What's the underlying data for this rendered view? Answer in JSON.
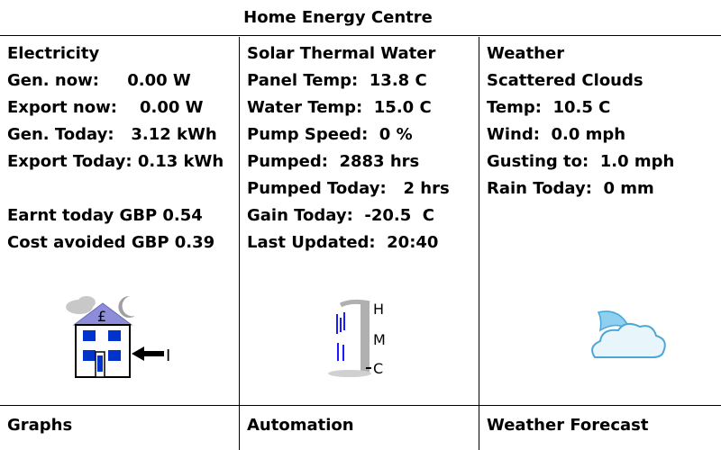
{
  "header": {
    "title": "Home Energy Centre"
  },
  "electricity": {
    "heading": "Electricity",
    "gen_now": "Gen. now:     0.00 W",
    "export_now": "Export now:    0.00 W",
    "gen_today": "Gen. Today:   3.12 kWh",
    "export_today": "Export Today: 0.13 kWh",
    "earnt_today": "Earnt today GBP 0.54",
    "cost_avoided": "Cost avoided GBP 0.39",
    "icon": "house-export-icon",
    "icon_text": {
      "pound": "£",
      "mark": "I"
    }
  },
  "solar": {
    "heading": "Solar Thermal Water",
    "panel_temp": "Panel Temp:  13.8 C",
    "water_temp": "Water Temp:  15.0 C",
    "pump_speed": "Pump Speed:  0 %",
    "pumped": "Pumped:  2883 hrs",
    "pumped_today": "Pumped Today:   2 hrs",
    "gain_today": "Gain Today:  -20.5  C",
    "last_updated": "Last Updated:  20:40",
    "icon": "hot-water-tank-icon",
    "tank_labels": {
      "high": "H",
      "mid": "M",
      "cold": "C"
    }
  },
  "weather": {
    "heading": "Weather",
    "condition": "Scattered Clouds",
    "temp": "Temp:  10.5 C",
    "wind": "Wind:  0.0 mph",
    "gusting": "Gusting to:  1.0 mph",
    "rain_today": "Rain Today:  0 mm",
    "icon": "moon-cloud-icon"
  },
  "footer": {
    "graphs": "Graphs",
    "automation": "Automation",
    "forecast": "Weather Forecast"
  },
  "colors": {
    "border": "#000000",
    "house_blue": "#0033cc",
    "roof": "#8c8cd9",
    "cloud_light": "#e8f6fb",
    "cloud_outline": "#4aa7d8",
    "moon": "#8fd0f0",
    "tank_grey": "#b0b0b0",
    "water_blue": "#1a1aff"
  }
}
